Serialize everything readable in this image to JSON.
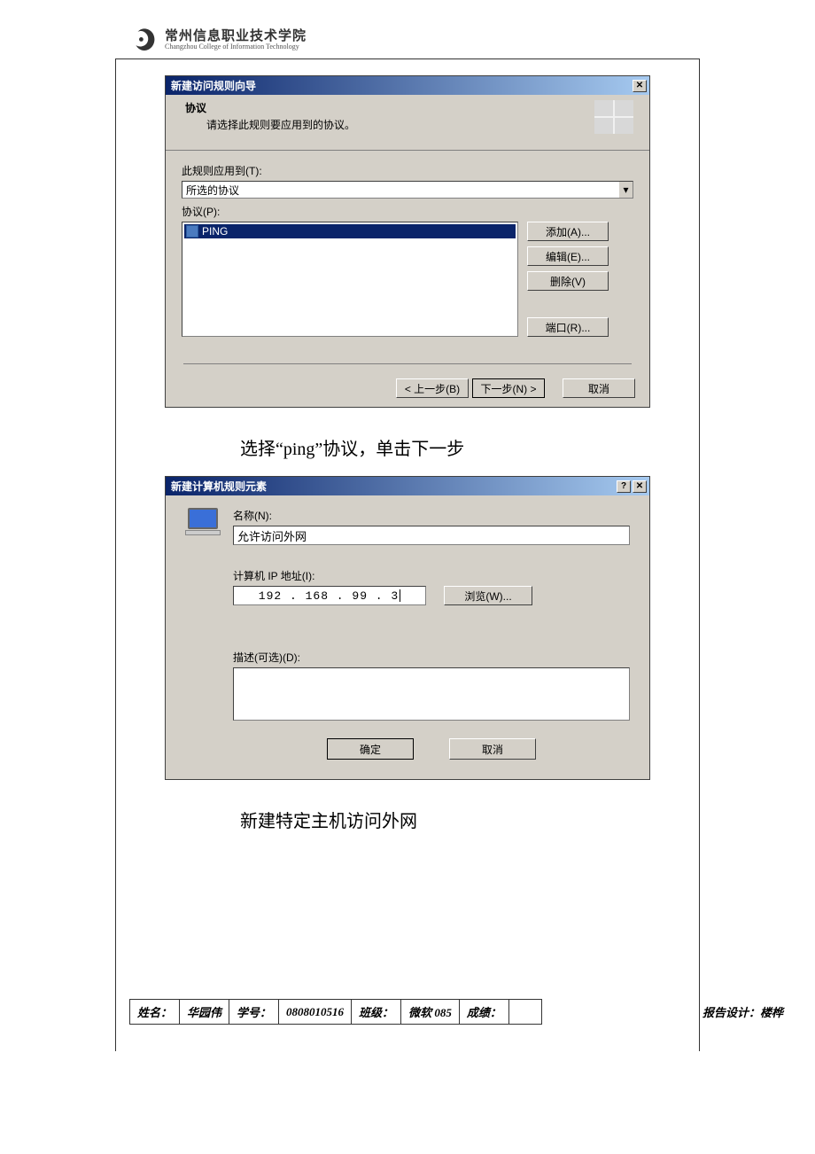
{
  "header": {
    "institution_cn": "常州信息职业技术学院",
    "institution_en": "Changzhou College of Information Technology"
  },
  "dialog1": {
    "title": "新建访问规则向导",
    "section_title": "协议",
    "section_sub": "请选择此规则要应用到的协议。",
    "applies_label": "此规则应用到(T):",
    "applies_value": "所选的协议",
    "protocols_label": "协议(P):",
    "list_item": "PING",
    "btn_add": "添加(A)...",
    "btn_edit": "编辑(E)...",
    "btn_remove": "删除(V)",
    "btn_ports": "端口(R)...",
    "btn_back": "< 上一步(B)",
    "btn_next": "下一步(N) >",
    "btn_cancel": "取消"
  },
  "caption1": "选择“ping”协议，单击下一步",
  "dialog2": {
    "title": "新建计算机规则元素",
    "name_label": "名称(N):",
    "name_value": "允许访问外网",
    "ip_label": "计算机 IP 地址(I):",
    "ip_value": "192 . 168 .  99 .   3",
    "browse": "浏览(W)...",
    "desc_label": "描述(可选)(D):",
    "ok": "确定",
    "cancel": "取消"
  },
  "caption2": "新建特定主机访问外网",
  "footer": {
    "name_label": "姓名：",
    "name_value": "华园伟",
    "id_label": "学号：",
    "id_value": "0808010516",
    "class_label": "班级：",
    "class_value": "微软 085",
    "score_label": "成绩：",
    "designer": "报告设计：楼桦"
  }
}
